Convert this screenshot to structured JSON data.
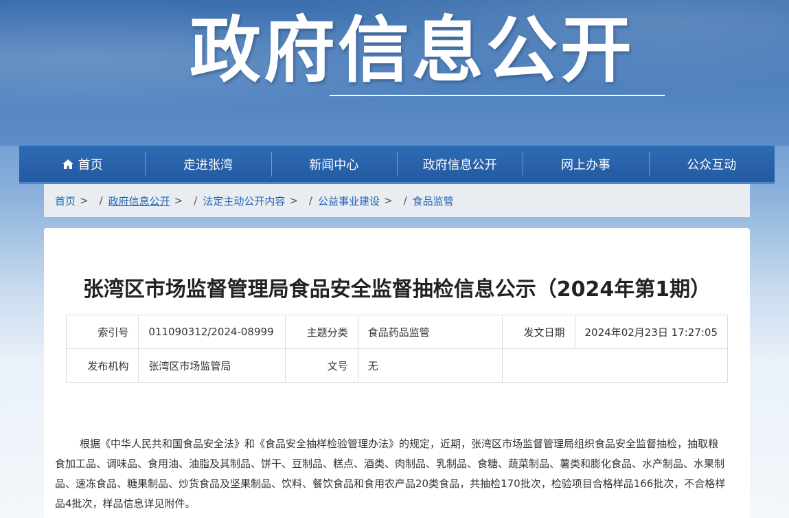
{
  "banner": {
    "title": "政府信息公开"
  },
  "nav": {
    "items": [
      {
        "label": "首页",
        "icon": "home-icon"
      },
      {
        "label": "走进张湾"
      },
      {
        "label": "新闻中心"
      },
      {
        "label": "政府信息公开"
      },
      {
        "label": "网上办事"
      },
      {
        "label": "公众互动"
      }
    ]
  },
  "breadcrumb": {
    "items": [
      "首页",
      "政府信息公开",
      "法定主动公开内容",
      "公益事业建设",
      "食品监管"
    ],
    "separator": ">",
    "slash": "/"
  },
  "article": {
    "title": "张湾区市场监督管理局食品安全监督抽检信息公示（2024年第1期）",
    "meta": {
      "index_label": "索引号",
      "index_value": "011090312/2024-08999",
      "topic_label": "主题分类",
      "topic_value": "食品药品监管",
      "date_label": "发文日期",
      "date_value": "2024年02月23日 17:27:05",
      "org_label": "发布机构",
      "org_value": "张湾区市场监管局",
      "docno_label": "文号",
      "docno_value": "无"
    },
    "body": "根据《中华人民共和国食品安全法》和《食品安全抽样检验管理办法》的规定，近期，张湾区市场监督管理局组织食品安全监督抽检，抽取粮食加工品、调味品、食用油、油脂及其制品、饼干、豆制品、糕点、酒类、肉制品、乳制品、食糖、蔬菜制品、薯类和膨化食品、水产制品、水果制品、速冻食品、糖果制品、炒货食品及坚果制品、饮料、餐饮食品和食用农产品20类食品，共抽检170批次，检验项目合格样品166批次，不合格样品4批次，样品信息详见附件。"
  }
}
